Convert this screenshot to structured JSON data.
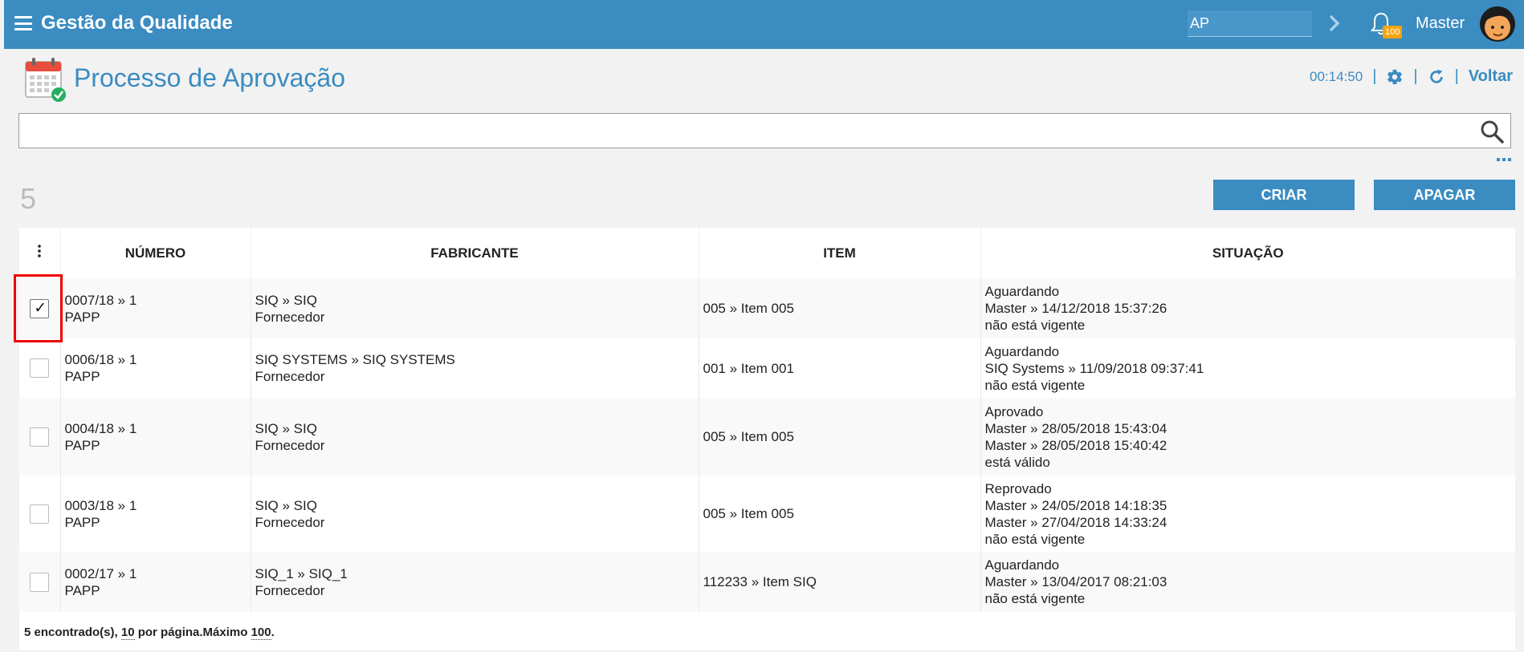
{
  "topbar": {
    "title": "Gestão da Qualidade",
    "module_value": "AP",
    "notification_count": "100",
    "user_name": "Master"
  },
  "page": {
    "title": "Processo de Aprovação",
    "timer": "00:14:50",
    "back_label": "Voltar"
  },
  "search": {
    "value": "",
    "placeholder": ""
  },
  "count": "5",
  "buttons": {
    "create": "CRIAR",
    "delete": "APAGAR"
  },
  "table": {
    "columns": [
      "NÚMERO",
      "FABRICANTE",
      "ITEM",
      "SITUAÇÃO"
    ],
    "rows": [
      {
        "checked": true,
        "numero": [
          "0007/18 » 1",
          "PAPP"
        ],
        "fabricante": [
          "SIQ » SIQ",
          "Fornecedor"
        ],
        "item": "005 » Item 005",
        "situacao": [
          "Aguardando",
          "Master » 14/12/2018 15:37:26",
          "não está vigente"
        ]
      },
      {
        "checked": false,
        "numero": [
          "0006/18 » 1",
          "PAPP"
        ],
        "fabricante": [
          "SIQ SYSTEMS » SIQ SYSTEMS",
          "Fornecedor"
        ],
        "item": "001 » Item 001",
        "situacao": [
          "Aguardando",
          "SIQ Systems » 11/09/2018 09:37:41",
          "não está vigente"
        ]
      },
      {
        "checked": false,
        "numero": [
          "0004/18 » 1",
          "PAPP"
        ],
        "fabricante": [
          "SIQ » SIQ",
          "Fornecedor"
        ],
        "item": "005 » Item 005",
        "situacao": [
          "Aprovado",
          "Master » 28/05/2018 15:43:04",
          "Master » 28/05/2018 15:40:42",
          "está válido"
        ]
      },
      {
        "checked": false,
        "numero": [
          "0003/18 » 1",
          "PAPP"
        ],
        "fabricante": [
          "SIQ » SIQ",
          "Fornecedor"
        ],
        "item": "005 » Item 005",
        "situacao": [
          "Reprovado",
          "Master » 24/05/2018 14:18:35",
          "Master » 27/04/2018 14:33:24",
          "não está vigente"
        ]
      },
      {
        "checked": false,
        "numero": [
          "0002/17 » 1",
          "PAPP"
        ],
        "fabricante": [
          "SIQ_1 » SIQ_1",
          "Fornecedor"
        ],
        "item": "112233 » Item SIQ",
        "situacao": [
          "Aguardando",
          "Master » 13/04/2017 08:21:03",
          "não está vigente"
        ]
      }
    ]
  },
  "footer": {
    "found": "5 encontrado(s),",
    "per_page_value": "10",
    "per_page_label": " por página.Máximo ",
    "max_value": "100",
    "end": "."
  },
  "colors": {
    "primary": "#3a8cc1",
    "badge": "#f7a30c",
    "highlight": "#e00000"
  }
}
